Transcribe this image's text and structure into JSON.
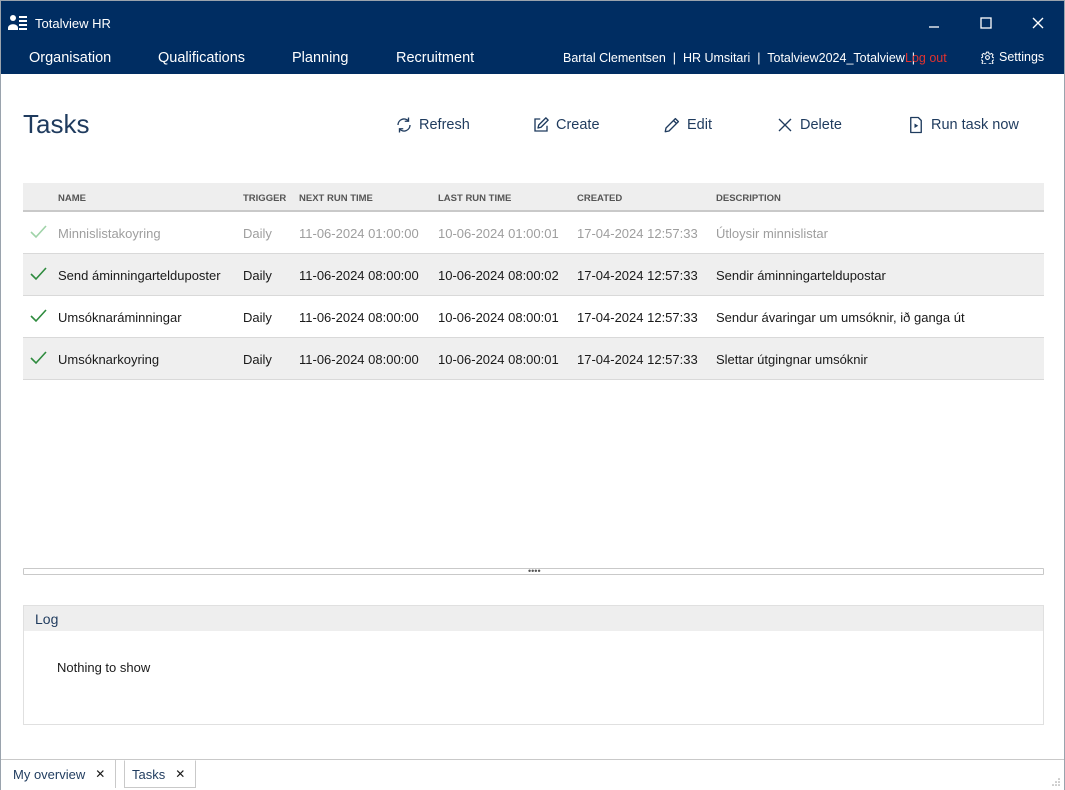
{
  "window": {
    "title": "Totalview HR",
    "logo_icon": "person-list-icon",
    "controls": [
      "minimize-icon",
      "maximize-icon",
      "close-icon"
    ]
  },
  "nav": {
    "items": [
      "Organisation",
      "Qualifications",
      "Planning",
      "Recruitment"
    ],
    "user_info": "Bartal Clementsen  |  HR Umsitari  |  Totalview2024_Totalview  |",
    "logout": "Log out",
    "settings": "Settings"
  },
  "page": {
    "title": "Tasks"
  },
  "toolbar": {
    "refresh": "Refresh",
    "create": "Create",
    "edit": "Edit",
    "delete": "Delete",
    "run": "Run task now"
  },
  "table": {
    "columns": [
      "NAME",
      "TRIGGER",
      "NEXT RUN TIME",
      "LAST RUN TIME",
      "CREATED",
      "DESCRIPTION"
    ],
    "rows": [
      {
        "name": "Minnislistakoyring",
        "trigger": "Daily",
        "next_run": "11-06-2024 01:00:00",
        "last_run": "10-06-2024 01:00:01",
        "created": "17-04-2024 12:57:33",
        "description": "Útloysir minnislistar",
        "status_icon": "check-icon",
        "enabled": false
      },
      {
        "name": "Send áminningartelduposter",
        "trigger": "Daily",
        "next_run": "11-06-2024 08:00:00",
        "last_run": "10-06-2024 08:00:02",
        "created": "17-04-2024 12:57:33",
        "description": "Sendir áminningarteldupostar",
        "status_icon": "check-icon",
        "enabled": true
      },
      {
        "name": "Umsóknaráminningar",
        "trigger": "Daily",
        "next_run": "11-06-2024 08:00:00",
        "last_run": "10-06-2024 08:00:01",
        "created": "17-04-2024 12:57:33",
        "description": "Sendur ávaringar um umsóknir, ið ganga út",
        "status_icon": "check-icon",
        "enabled": true
      },
      {
        "name": "Umsóknarkoyring",
        "trigger": "Daily",
        "next_run": "11-06-2024 08:00:00",
        "last_run": "10-06-2024 08:00:01",
        "created": "17-04-2024 12:57:33",
        "description": "Slettar útgingnar umsóknir",
        "status_icon": "check-icon",
        "enabled": true
      }
    ]
  },
  "log": {
    "title": "Log",
    "empty": "Nothing to show"
  },
  "tabs": [
    {
      "label": "My overview",
      "close": "✕"
    },
    {
      "label": "Tasks",
      "close": "✕"
    }
  ],
  "colors": {
    "titlebar": "#002d62",
    "accent_text": "#1f3b5e",
    "logout": "#e0322f",
    "check_enabled": "#2e8b3e",
    "check_disabled": "#9fd3a8"
  }
}
